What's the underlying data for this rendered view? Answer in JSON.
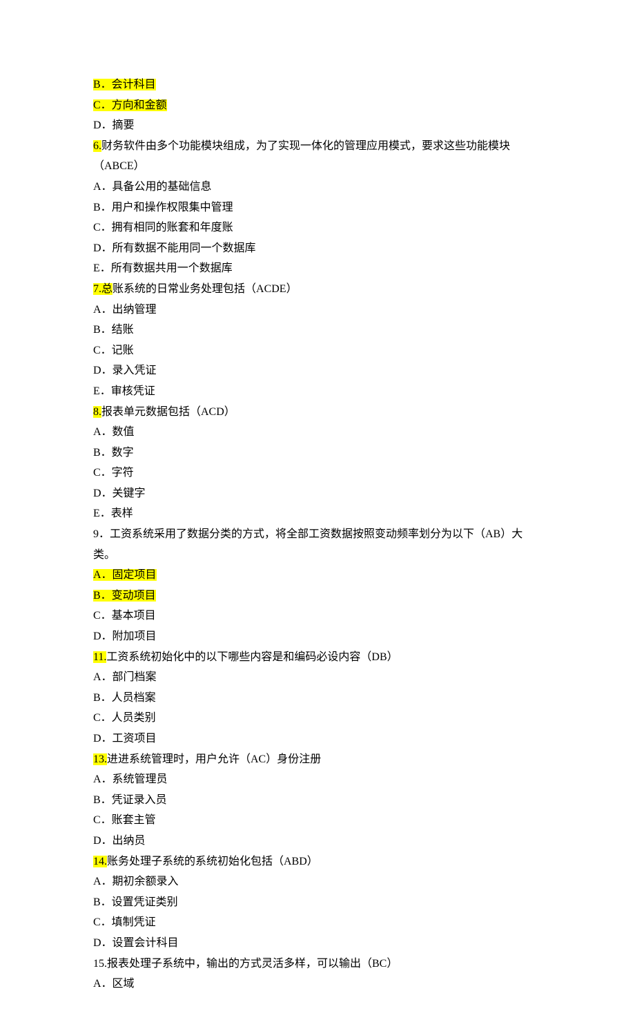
{
  "lines": [
    {
      "segments": [
        {
          "text": "B．会计科目",
          "highlight": true
        }
      ]
    },
    {
      "segments": [
        {
          "text": "C．方向和金额",
          "highlight": true
        }
      ]
    },
    {
      "segments": [
        {
          "text": "D．摘要",
          "highlight": false
        }
      ]
    },
    {
      "segments": [
        {
          "text": "6.",
          "highlight": true
        },
        {
          "text": "财务软件由多个功能模块组成，为了实现一体化的管理应用模式，要求这些功能模块（ABCE）",
          "highlight": false
        }
      ]
    },
    {
      "segments": [
        {
          "text": "A．具备公用的基础信息",
          "highlight": false
        }
      ]
    },
    {
      "segments": [
        {
          "text": "B．用户和操作权限集中管理",
          "highlight": false
        }
      ]
    },
    {
      "segments": [
        {
          "text": "C．拥有相同的账套和年度账",
          "highlight": false
        }
      ]
    },
    {
      "segments": [
        {
          "text": "D．所有数据不能用同一个数据库",
          "highlight": false
        }
      ]
    },
    {
      "segments": [
        {
          "text": "E．所有数据共用一个数据库",
          "highlight": false
        }
      ]
    },
    {
      "segments": [
        {
          "text": "7.总",
          "highlight": true
        },
        {
          "text": "账系统的日常业务处理包括（ACDE）",
          "highlight": false
        }
      ]
    },
    {
      "segments": [
        {
          "text": "A．出纳管理",
          "highlight": false
        }
      ]
    },
    {
      "segments": [
        {
          "text": "B．结账",
          "highlight": false
        }
      ]
    },
    {
      "segments": [
        {
          "text": "C．记账",
          "highlight": false
        }
      ]
    },
    {
      "segments": [
        {
          "text": "D．录入凭证",
          "highlight": false
        }
      ]
    },
    {
      "segments": [
        {
          "text": "E．审核凭证",
          "highlight": false
        }
      ]
    },
    {
      "segments": [
        {
          "text": "8.",
          "highlight": true
        },
        {
          "text": "报表单元数据包括（ACD）",
          "highlight": false
        }
      ]
    },
    {
      "segments": [
        {
          "text": "A．数值",
          "highlight": false
        }
      ]
    },
    {
      "segments": [
        {
          "text": "B．数字",
          "highlight": false
        }
      ]
    },
    {
      "segments": [
        {
          "text": "C．字符",
          "highlight": false
        }
      ]
    },
    {
      "segments": [
        {
          "text": "D．关键字",
          "highlight": false
        }
      ]
    },
    {
      "segments": [
        {
          "text": "E．表样",
          "highlight": false
        }
      ]
    },
    {
      "segments": [
        {
          "text": "9．工资系统采用了数据分类的方式，将全部工资数据按照变动频率划分为以下（AB）大类。",
          "highlight": false
        }
      ]
    },
    {
      "segments": [
        {
          "text": "A．固定项目",
          "highlight": true
        }
      ]
    },
    {
      "segments": [
        {
          "text": "B．变动项目",
          "highlight": true
        }
      ]
    },
    {
      "segments": [
        {
          "text": "C．基本项目",
          "highlight": false
        }
      ]
    },
    {
      "segments": [
        {
          "text": "D．附加项目",
          "highlight": false
        }
      ]
    },
    {
      "segments": [
        {
          "text": "11.",
          "highlight": true
        },
        {
          "text": "工资系统初始化中的以下哪些内容是和编码必设内容（DB）",
          "highlight": false
        }
      ]
    },
    {
      "segments": [
        {
          "text": "A．部门档案",
          "highlight": false
        }
      ]
    },
    {
      "segments": [
        {
          "text": "B．人员档案",
          "highlight": false
        }
      ]
    },
    {
      "segments": [
        {
          "text": "C．人员类别",
          "highlight": false
        }
      ]
    },
    {
      "segments": [
        {
          "text": "D．工资项目",
          "highlight": false
        }
      ]
    },
    {
      "segments": [
        {
          "text": "13.",
          "highlight": true
        },
        {
          "text": "进进系统管理时，用户允许（AC）身份注册",
          "highlight": false
        }
      ]
    },
    {
      "segments": [
        {
          "text": "A．系统管理员",
          "highlight": false
        }
      ]
    },
    {
      "segments": [
        {
          "text": "B．凭证录入员",
          "highlight": false
        }
      ]
    },
    {
      "segments": [
        {
          "text": "C．账套主管",
          "highlight": false
        }
      ]
    },
    {
      "segments": [
        {
          "text": "D．出纳员",
          "highlight": false
        }
      ]
    },
    {
      "segments": [
        {
          "text": "14.",
          "highlight": true
        },
        {
          "text": "账务处理子系统的系统初始化包括（ABD）",
          "highlight": false
        }
      ]
    },
    {
      "segments": [
        {
          "text": "A．期初余额录入",
          "highlight": false
        }
      ]
    },
    {
      "segments": [
        {
          "text": "B．设置凭证类别",
          "highlight": false
        }
      ]
    },
    {
      "segments": [
        {
          "text": "C．填制凭证",
          "highlight": false
        }
      ]
    },
    {
      "segments": [
        {
          "text": "D．设置会计科目",
          "highlight": false
        }
      ]
    },
    {
      "segments": [
        {
          "text": "15.报表处理子系统中，输出的方式灵活多样，可以输出（BC）",
          "highlight": false
        }
      ]
    },
    {
      "segments": [
        {
          "text": "A．区域",
          "highlight": false
        }
      ]
    }
  ]
}
